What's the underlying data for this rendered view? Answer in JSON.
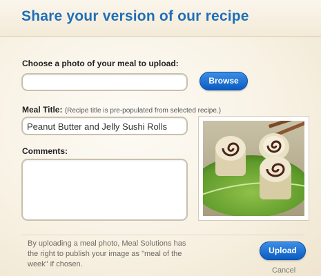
{
  "header": {
    "title": "Share your version of our recipe"
  },
  "upload": {
    "label": "Choose a photo of your meal to upload:",
    "file_value": "",
    "browse_label": "Browse"
  },
  "meal_title": {
    "label": "Meal Title:",
    "hint": "(Recipe title is pre-populated from selected recipe.)",
    "value": "Peanut Butter and Jelly Sushi Rolls"
  },
  "comments": {
    "label": "Comments:",
    "value": ""
  },
  "photo": {
    "subject": "peanut butter and jelly sushi rolls on a leaf"
  },
  "footer": {
    "disclaimer": "By uploading a meal photo, Meal Solutions has the right to publish your image as \"meal of the week\" if chosen.",
    "upload_label": "Upload",
    "cancel_label": "Cancel"
  },
  "colors": {
    "accent": "#1f6fb8",
    "button": "#0b5cc2",
    "background": "#f6efe0"
  }
}
